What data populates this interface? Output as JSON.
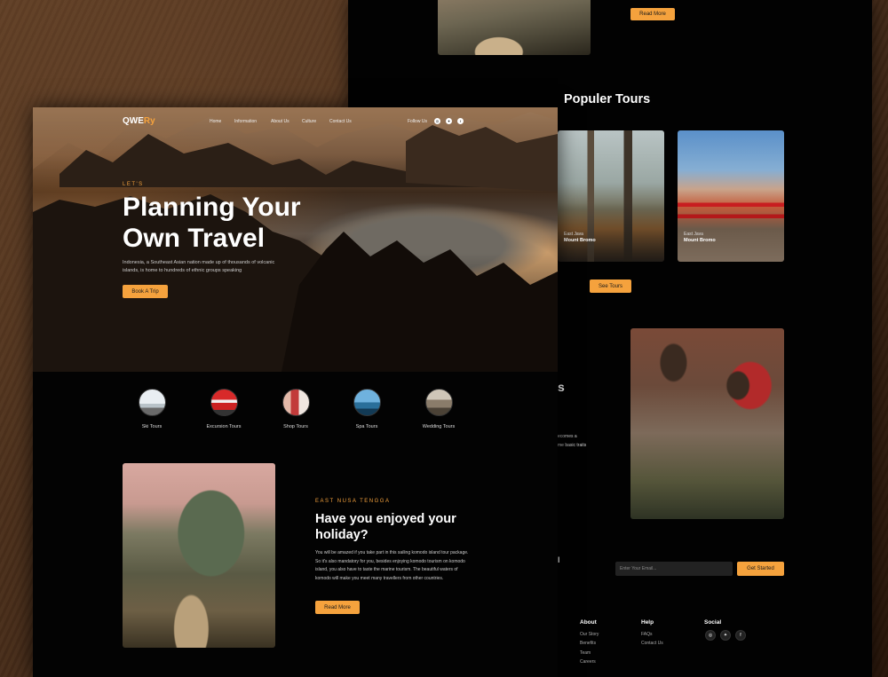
{
  "back": {
    "top_read_more": "Read More",
    "popular_title": "Populer Tours",
    "tours": [
      {
        "location": "East Java",
        "name": "Mount Bromo"
      },
      {
        "location": "East Java",
        "name": "Mount Bromo"
      }
    ],
    "see_tours": "See Tours",
    "cut_heading": "s",
    "cut_text_1": "ecomes a",
    "cut_text_2": "me basic traits",
    "cut_mark": "l",
    "email_placeholder": "Enter Your Email...",
    "get_started": "Get Started",
    "footer": {
      "about": {
        "title": "About",
        "links": [
          "Our Story",
          "Benefits",
          "Team",
          "Careers"
        ]
      },
      "help": {
        "title": "Help",
        "links": [
          "FAQs",
          "Contact Us"
        ]
      },
      "social": {
        "title": "Social",
        "icons": [
          "instagram-icon",
          "twitter-icon",
          "facebook-icon"
        ]
      }
    }
  },
  "front": {
    "logo_main": "QWE",
    "logo_accent": "Ry",
    "nav": [
      "Home",
      "Information",
      "About Us",
      "Culture",
      "Contact Us"
    ],
    "follow_us": "Follow Us",
    "hero": {
      "eyebrow": "LET'S",
      "title": "Planning Your Own Travel",
      "description": "Indonesia, a Southeast Asian nation made up of thousands of volcanic islands, is home to hundreds of ethnic groups speaking",
      "button": "Book A Trip"
    },
    "categories": [
      {
        "label": "Ski Tours"
      },
      {
        "label": "Excursion Tours"
      },
      {
        "label": "Shop Tours"
      },
      {
        "label": "Spa Tours"
      },
      {
        "label": "Wedding Tours"
      }
    ],
    "enjoy": {
      "eyebrow": "EAST NUSA TENGGA",
      "title": "Have you enjoyed your holiday?",
      "description": "You will be amazed if you take part in this sailing komodo island tour package. So it's also mandatory for you, besides enjoying komodo tourism on komodo island, you also have to taste the marine tourism. The beautiful waters of komodo will make you meet many travellers from other countries.",
      "button": "Read More"
    }
  },
  "colors": {
    "accent": "#f5a23d",
    "page_bg": "#030303",
    "desk": "#4a2f1c"
  }
}
